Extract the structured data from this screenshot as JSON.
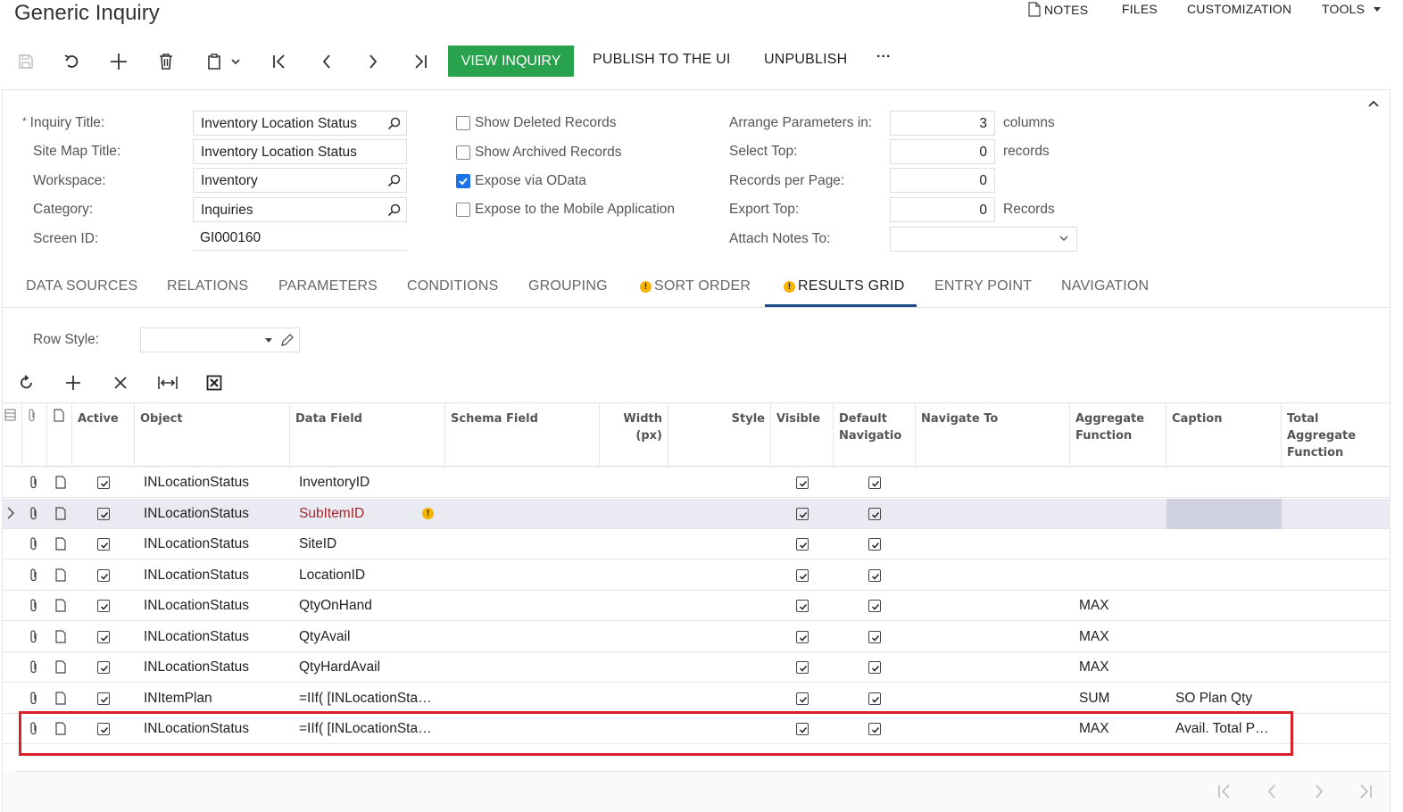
{
  "header": {
    "title": "Generic Inquiry",
    "links": [
      {
        "label": "NOTES"
      },
      {
        "label": "FILES"
      },
      {
        "label": "CUSTOMIZATION"
      },
      {
        "label": "TOOLS"
      }
    ]
  },
  "toolbar": {
    "view_inquiry": "VIEW INQUIRY",
    "publish": "PUBLISH TO THE UI",
    "unpublish": "UNPUBLISH",
    "more": "···",
    "accent_color": "#29a24d"
  },
  "form": {
    "inquiry_title_label": "Inquiry Title:",
    "inquiry_title_value": "Inventory Location Status",
    "site_map_title_label": "Site Map Title:",
    "site_map_title_value": "Inventory Location Status",
    "workspace_label": "Workspace:",
    "workspace_value": "Inventory",
    "category_label": "Category:",
    "category_value": "Inquiries",
    "screen_id_label": "Screen ID:",
    "screen_id_value": "GI000160",
    "show_deleted": {
      "label": "Show Deleted Records",
      "checked": false
    },
    "show_archived": {
      "label": "Show Archived Records",
      "checked": false
    },
    "expose_odata": {
      "label": "Expose via OData",
      "checked": true
    },
    "expose_mobile": {
      "label": "Expose to the Mobile Application",
      "checked": false
    },
    "arrange_label": "Arrange Parameters in:",
    "arrange_value": "3",
    "arrange_suffix": "columns",
    "select_top_label": "Select Top:",
    "select_top_value": "0",
    "select_top_suffix": "records",
    "records_per_page_label": "Records per Page:",
    "records_per_page_value": "0",
    "export_top_label": "Export Top:",
    "export_top_value": "0",
    "export_top_suffix": "Records",
    "attach_notes_label": "Attach Notes To:",
    "attach_notes_value": ""
  },
  "tabs": [
    {
      "label": "DATA SOURCES"
    },
    {
      "label": "RELATIONS"
    },
    {
      "label": "PARAMETERS"
    },
    {
      "label": "CONDITIONS"
    },
    {
      "label": "GROUPING"
    },
    {
      "label": "SORT ORDER",
      "warning": true
    },
    {
      "label": "RESULTS GRID",
      "warning": true,
      "active": true
    },
    {
      "label": "ENTRY POINT"
    },
    {
      "label": "NAVIGATION"
    }
  ],
  "results_grid": {
    "row_style_label": "Row Style:",
    "row_style_value": "",
    "columns": {
      "active": "Active",
      "object": "Object",
      "data_field": "Data Field",
      "schema_field": "Schema Field",
      "width": "Width (px)",
      "style": "Style",
      "visible": "Visible",
      "default_nav": "Default Navigatio",
      "navigate_to": "Navigate To",
      "aggregate": "Aggregate Function",
      "caption": "Caption",
      "total_agg": "Total Aggregate Function"
    },
    "rows": [
      {
        "object": "INLocationStatus",
        "data_field": "InventoryID",
        "aggregate": "",
        "caption": ""
      },
      {
        "object": "INLocationStatus",
        "data_field": "SubItemID",
        "aggregate": "",
        "caption": "",
        "selected": true,
        "warning": true
      },
      {
        "object": "INLocationStatus",
        "data_field": "SiteID",
        "aggregate": "",
        "caption": ""
      },
      {
        "object": "INLocationStatus",
        "data_field": "LocationID",
        "aggregate": "",
        "caption": ""
      },
      {
        "object": "INLocationStatus",
        "data_field": "QtyOnHand",
        "aggregate": "MAX",
        "caption": ""
      },
      {
        "object": "INLocationStatus",
        "data_field": "QtyAvail",
        "aggregate": "MAX",
        "caption": ""
      },
      {
        "object": "INLocationStatus",
        "data_field": "QtyHardAvail",
        "aggregate": "MAX",
        "caption": ""
      },
      {
        "object": "INItemPlan",
        "data_field": "=IIf( [INLocationSta…",
        "aggregate": "SUM",
        "caption": "SO Plan Qty"
      },
      {
        "object": "INLocationStatus",
        "data_field": "=IIf( [INLocationSta…",
        "aggregate": "MAX",
        "caption": "Avail. Total P…",
        "highlighted": true
      }
    ]
  }
}
